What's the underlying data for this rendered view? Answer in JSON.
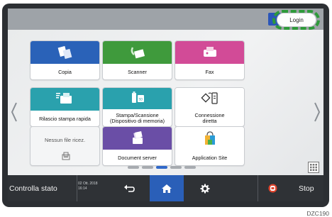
{
  "header": {
    "login_label": "Login"
  },
  "apps": [
    {
      "label": "Copia",
      "icon": "copy-icon",
      "color": "#2a62b8"
    },
    {
      "label": "Scanner",
      "icon": "scanner-icon",
      "color": "#3f9a3c"
    },
    {
      "label": "Fax",
      "icon": "fax-icon",
      "color": "#d24b97"
    },
    {
      "label": "Rilascio stampa rapida",
      "icon": "quick-print-icon",
      "color": "#2aa1ad"
    },
    {
      "label": "Stampa/Scansione\n(Dispositivo di memoria)",
      "icon": "memory-device-icon",
      "color": "#2aa1ad"
    },
    {
      "label": "Connessione\ndiretta",
      "icon": "direct-connection-icon",
      "color": "#ffffff"
    },
    {
      "label": "Document server",
      "icon": "document-server-icon",
      "color": "#6a4ea6"
    },
    {
      "label": "Application Site",
      "icon": "application-site-icon",
      "color": "#ffffff"
    }
  ],
  "empty_tile": {
    "label": "Nessun file ricez."
  },
  "pager": {
    "pages": 5,
    "active_page": 3
  },
  "bottombar": {
    "status_label": "Controlla stato",
    "date": "02 Ott. 2018",
    "time": "16:14",
    "stop_label": "Stop"
  },
  "figure_id": "DZC190"
}
